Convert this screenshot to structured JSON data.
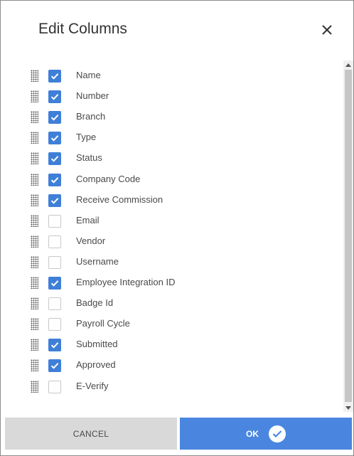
{
  "dialog": {
    "title": "Edit Columns",
    "close_icon": "close-icon"
  },
  "columns": [
    {
      "label": "Name",
      "checked": true
    },
    {
      "label": "Number",
      "checked": true
    },
    {
      "label": "Branch",
      "checked": true
    },
    {
      "label": "Type",
      "checked": true
    },
    {
      "label": "Status",
      "checked": true
    },
    {
      "label": "Company Code",
      "checked": true
    },
    {
      "label": "Receive Commission",
      "checked": true
    },
    {
      "label": "Email",
      "checked": false
    },
    {
      "label": "Vendor",
      "checked": false
    },
    {
      "label": "Username",
      "checked": false
    },
    {
      "label": "Employee Integration ID",
      "checked": true
    },
    {
      "label": "Badge Id",
      "checked": false
    },
    {
      "label": "Payroll Cycle",
      "checked": false
    },
    {
      "label": "Submitted",
      "checked": true
    },
    {
      "label": "Approved",
      "checked": true
    },
    {
      "label": "E-Verify",
      "checked": false
    }
  ],
  "footer": {
    "cancel_label": "CANCEL",
    "ok_label": "OK"
  },
  "colors": {
    "accent": "#4a86df",
    "checkbox_on": "#3f7fd8",
    "cancel_bg": "#d9d9d9"
  }
}
